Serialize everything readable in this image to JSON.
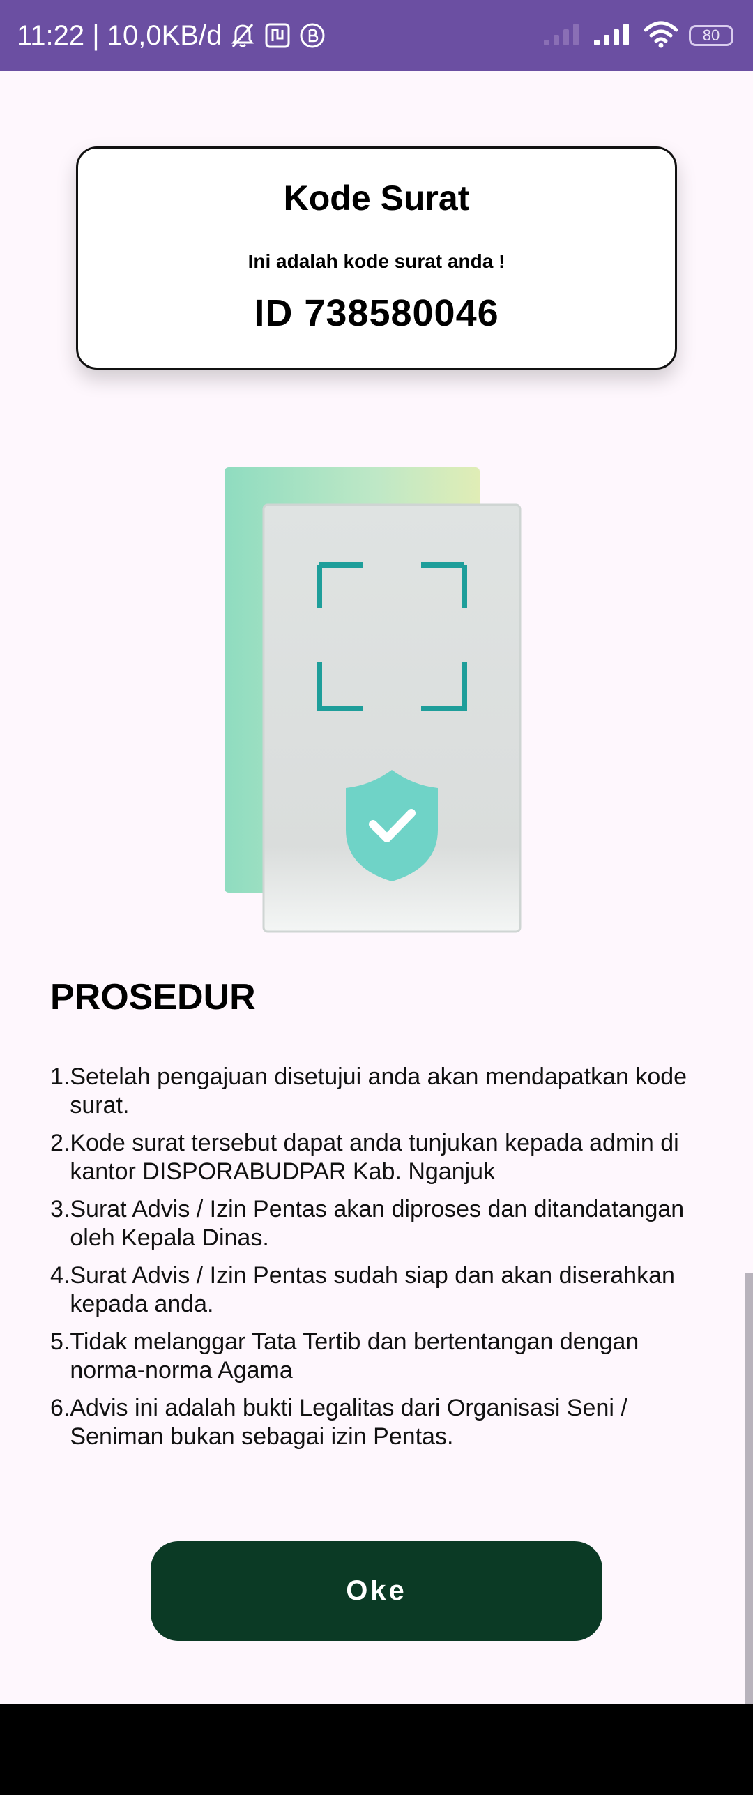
{
  "status_bar": {
    "time_speed": "11:22 | 10,0KB/d",
    "battery": "80",
    "icons": [
      "bell-off-icon",
      "nfc-icon",
      "b-app-icon",
      "signal-icon",
      "wifi-icon",
      "battery-icon"
    ]
  },
  "code_card": {
    "title": "Kode Surat",
    "subtitle": "Ini adalah kode surat anda !",
    "code": "ID 738580046"
  },
  "illustration": {
    "icon": "scan-shield-icon"
  },
  "procedure": {
    "title": "PROSEDUR",
    "items": [
      {
        "num": "1.",
        "text": "Setelah pengajuan disetujui anda akan mendapatkan kode surat."
      },
      {
        "num": "2.",
        "text": "Kode surat tersebut dapat anda tunjukan kepada admin di kantor DISPORABUDPAR Kab. Nganjuk"
      },
      {
        "num": "3.",
        "text": "Surat Advis / Izin Pentas akan diproses dan ditandatangan oleh Kepala Dinas."
      },
      {
        "num": "4.",
        "text": "Surat Advis / Izin Pentas sudah siap dan akan diserahkan kepada anda."
      },
      {
        "num": "5.",
        "text": "Tidak melanggar Tata Tertib dan bertentangan dengan norma-norma Agama"
      },
      {
        "num": "6.",
        "text": "Advis ini adalah bukti Legalitas dari Organisasi Seni / Seniman bukan sebagai izin Pentas."
      }
    ]
  },
  "button": {
    "label": "Oke"
  },
  "colors": {
    "status_bar": "#6B4FA2",
    "background": "#FEF7FD",
    "button": "#0B3A25",
    "accent_teal": "#1E9E9A"
  }
}
